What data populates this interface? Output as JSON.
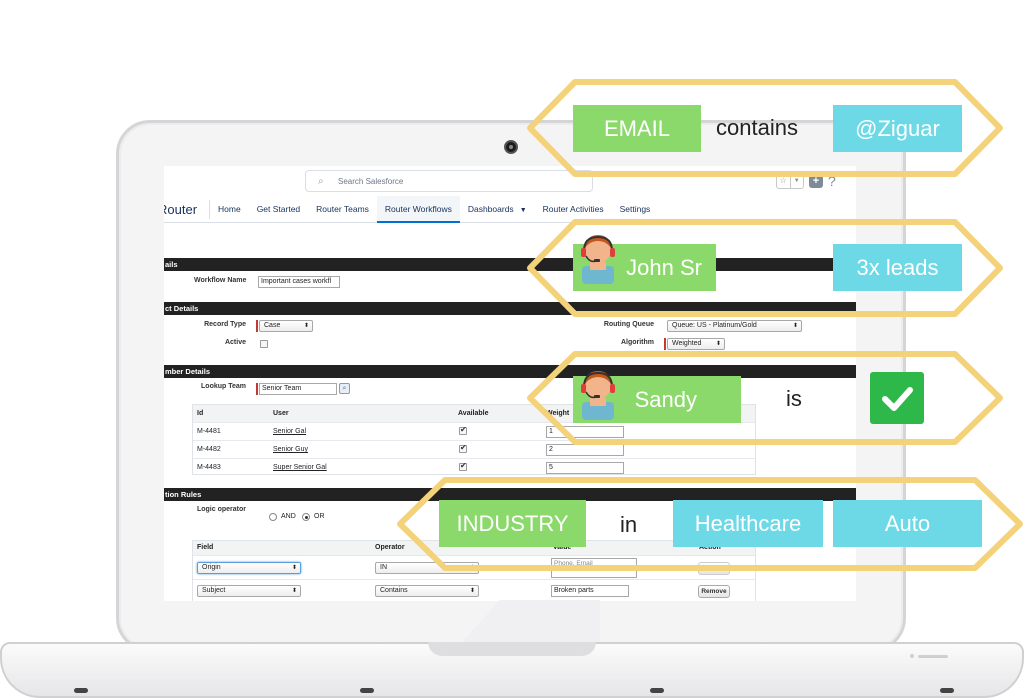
{
  "browser": {
    "search_placeholder": "Search Salesforce",
    "search_icon": "search-icon"
  },
  "nav": {
    "app_name": "Router",
    "items": [
      {
        "label": "Home",
        "active": false
      },
      {
        "label": "Get Started",
        "active": false
      },
      {
        "label": "Router Teams",
        "active": false
      },
      {
        "label": "Router Workflows",
        "active": true
      },
      {
        "label": "Dashboards",
        "active": false,
        "dropdown": true
      },
      {
        "label": "Router Activities",
        "active": false
      },
      {
        "label": "Settings",
        "active": false
      }
    ]
  },
  "sections": {
    "details": "ails",
    "object_details": "ct Details",
    "member_details": "mber Details",
    "rules": "tion Rules"
  },
  "workflow": {
    "name_label": "Workflow Name",
    "name_value": "Important cases workfl",
    "record_type_label": "Record Type",
    "record_type_value": "Case",
    "active_label": "Active",
    "routing_queue_label": "Routing Queue",
    "routing_queue_value": "Queue: US - Platinum/Gold",
    "algorithm_label": "Algorithm",
    "algorithm_value": "Weighted",
    "lookup_team_label": "Lookup Team",
    "lookup_team_value": "Senior Team"
  },
  "members": {
    "columns": [
      "Id",
      "User",
      "Available",
      "Weight"
    ],
    "rows": [
      {
        "id": "M-4481",
        "user": "Senior Gal",
        "available": true,
        "weight": "1"
      },
      {
        "id": "M-4482",
        "user": "Senior Guy",
        "available": true,
        "weight": "2"
      },
      {
        "id": "M-4483",
        "user": "Super Senior Gal",
        "available": true,
        "weight": "5"
      }
    ]
  },
  "rules": {
    "logic_label": "Logic operator",
    "and_label": "AND",
    "or_label": "OR",
    "selected": "OR",
    "columns": [
      "Field",
      "Operator",
      "Value",
      "Action"
    ],
    "rows": [
      {
        "field": "Origin",
        "operator": "IN",
        "value": "Phone, Email",
        "action": "Remove",
        "action_disabled": true
      },
      {
        "field": "Subject",
        "operator": "Contains",
        "value": "Broken parts",
        "action": "Remove",
        "action_disabled": false
      }
    ]
  },
  "callouts": {
    "row1": {
      "field": "EMAIL",
      "op": "contains",
      "value": "@Ziguar"
    },
    "row2": {
      "person": "John Sr",
      "value": "3x leads"
    },
    "row3": {
      "person": "Sandy",
      "op": "is",
      "badge_icon": "check-icon"
    },
    "row4": {
      "field": "INDUSTRY",
      "op": "in",
      "values": [
        "Healthcare",
        "Auto"
      ]
    }
  },
  "colors": {
    "chip_green": "#8bd96b",
    "chip_cyan": "#6ed9e6",
    "hex_outline": "#f3d27a",
    "check_green": "#2eb84a",
    "nav_active": "#0070d2"
  }
}
